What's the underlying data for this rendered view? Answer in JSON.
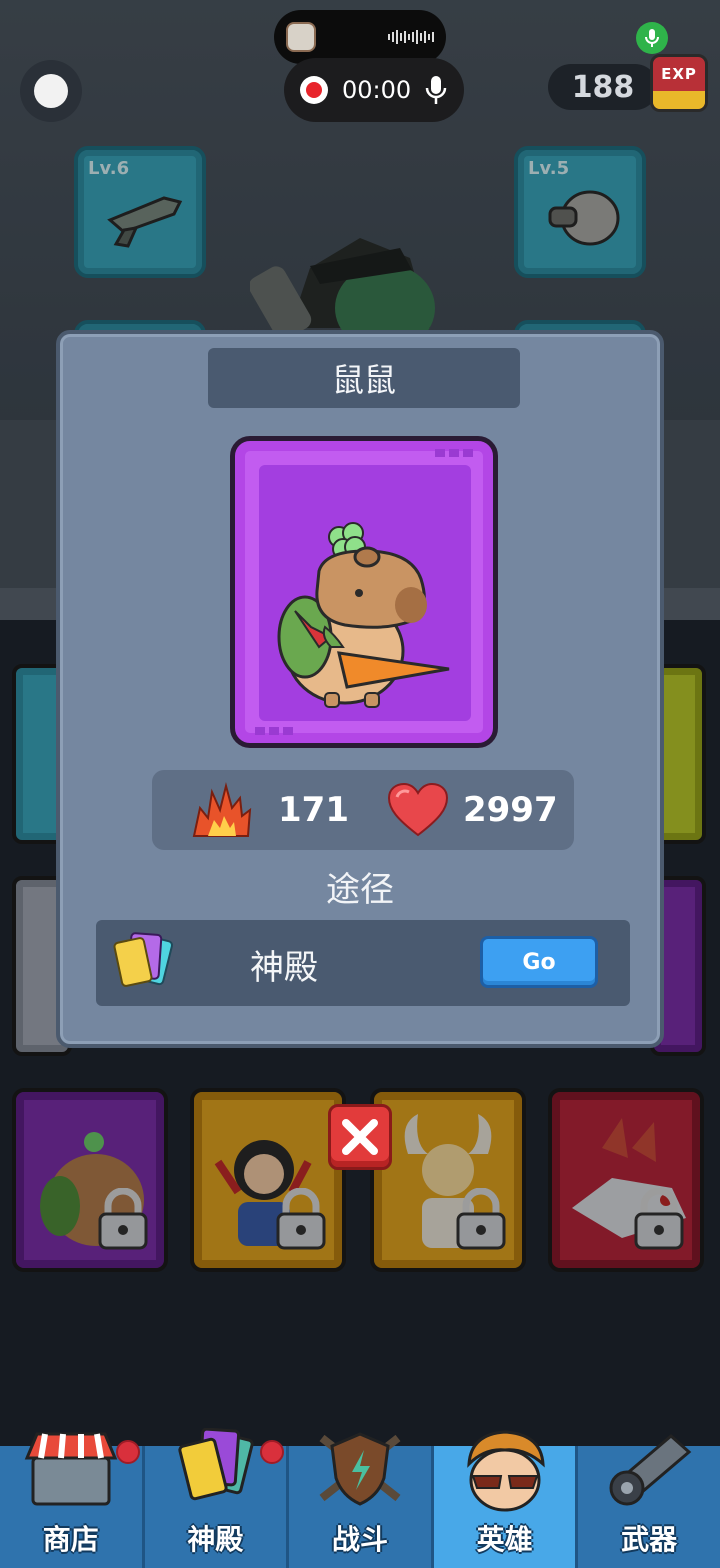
{
  "hud": {
    "recording_time": "00:00",
    "exp_value": "188",
    "exp_label": "EXP"
  },
  "equipment": {
    "left_slot_level": "Lv.6",
    "right_slot_level": "Lv.5"
  },
  "modal": {
    "title": "鼠鼠",
    "attack": "171",
    "health": "2997",
    "source_heading": "途径",
    "source_name": "神殿",
    "go_label": "Go"
  },
  "nav": {
    "items": [
      {
        "label": "商店",
        "badge": true
      },
      {
        "label": "神殿",
        "badge": true
      },
      {
        "label": "战斗",
        "badge": false
      },
      {
        "label": "英雄",
        "badge": false,
        "active": true
      },
      {
        "label": "武器",
        "badge": false
      }
    ]
  },
  "colors": {
    "modal_bg": "#7587a0",
    "portrait_purple": "#c25cf0",
    "go_button": "#3da0f2",
    "close_button": "#e23b3b",
    "nav_bg": "#2f73ad",
    "nav_active": "#48a8e8"
  },
  "icons": {
    "attack": "flame-icon",
    "health": "heart-icon",
    "source": "card-pack-icon",
    "close": "close-icon"
  }
}
